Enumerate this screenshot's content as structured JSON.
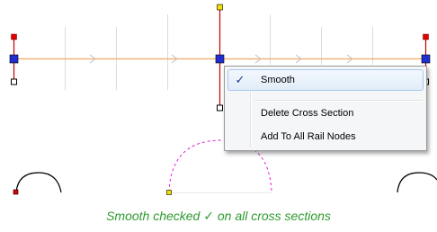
{
  "context_menu": {
    "items": [
      {
        "label": "Smooth",
        "checked": true,
        "check_glyph": "✓",
        "highlighted": true
      },
      {
        "label": "Delete Cross Section"
      },
      {
        "label": "Add To All Rail Nodes"
      }
    ]
  },
  "caption": "Smooth checked ✓ on all cross sections",
  "colors": {
    "rail_line": "#f0a860",
    "rail_node": "#1f2fd0",
    "red_stem": "#c00000",
    "ghost_arc": "#e020e0",
    "caption": "#2e9a2e",
    "menu_highlight_border": "#a8c8ef"
  }
}
